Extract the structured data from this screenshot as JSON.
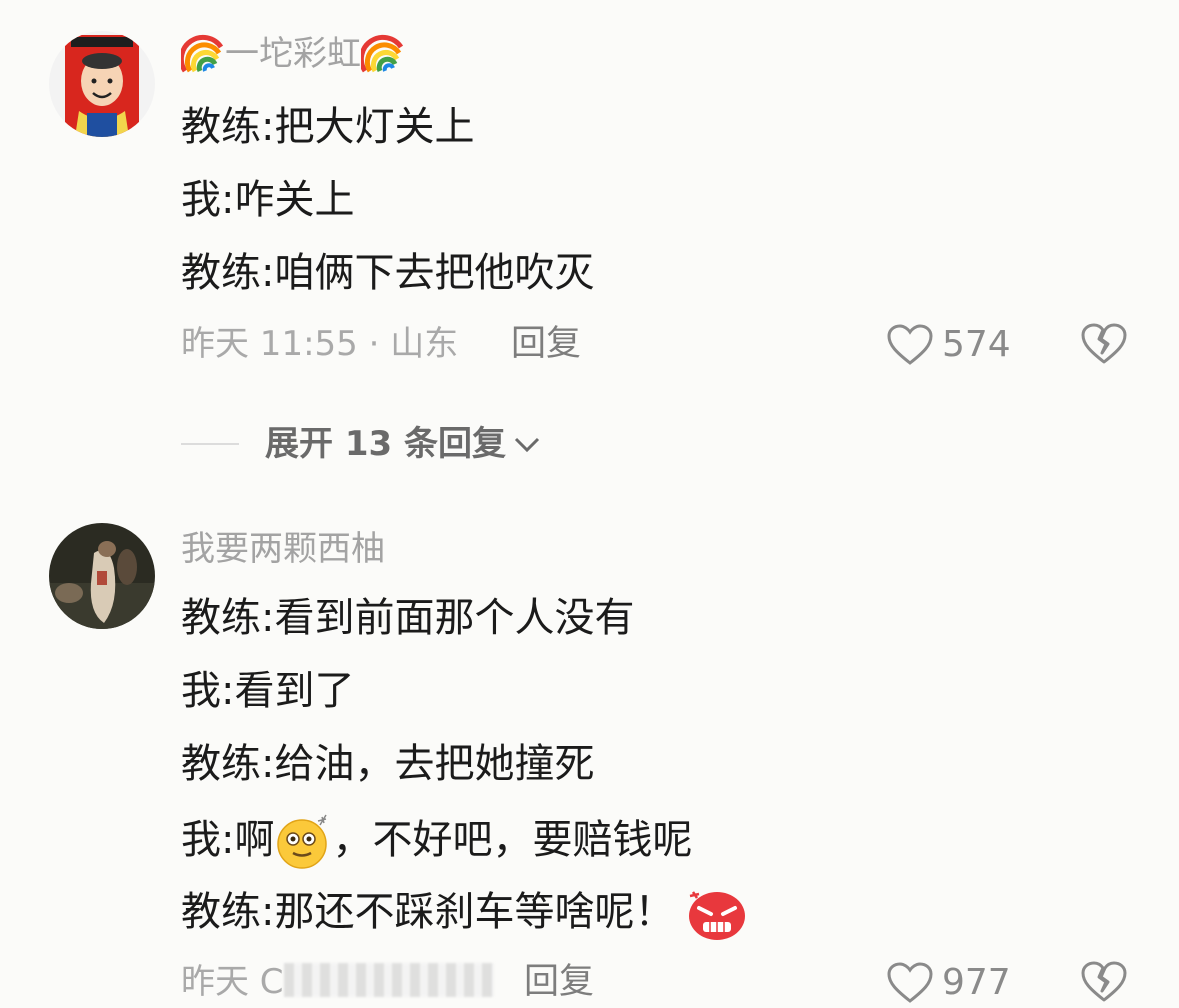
{
  "comments": [
    {
      "username": "一坨彩虹",
      "lines": [
        "教练:把大灯关上",
        "我:咋关上",
        "教练:咱俩下去把他吹灭"
      ],
      "time_location": "昨天 11:55 · 山东",
      "reply_label": "回复",
      "likes": "574"
    },
    {
      "username": "我要两颗西柚",
      "lines": {
        "l1": "教练:看到前面那个人没有",
        "l2": "我:看到了",
        "l3": "教练:给油，去把她撞死",
        "l4_a": "我:啊",
        "l4_b": "，不好吧，要赔钱呢",
        "l5": "教练:那还不踩刹车等啥呢！"
      },
      "time_prefix": "昨天 C",
      "reply_label": "回复",
      "likes": "977"
    }
  ],
  "expand_replies": "展开 13 条回复",
  "icons": {
    "like": "heart-outline-icon",
    "dislike": "broken-heart-icon",
    "expand": "chevron-down-icon",
    "rainbow": "rainbow-emoji",
    "dizzy": "dizzy-face-emoji",
    "angry": "angry-face-emoji"
  },
  "colors": {
    "background": "#fbfbf9",
    "text": "#1b1b1b",
    "muted": "#a9a9a9"
  }
}
